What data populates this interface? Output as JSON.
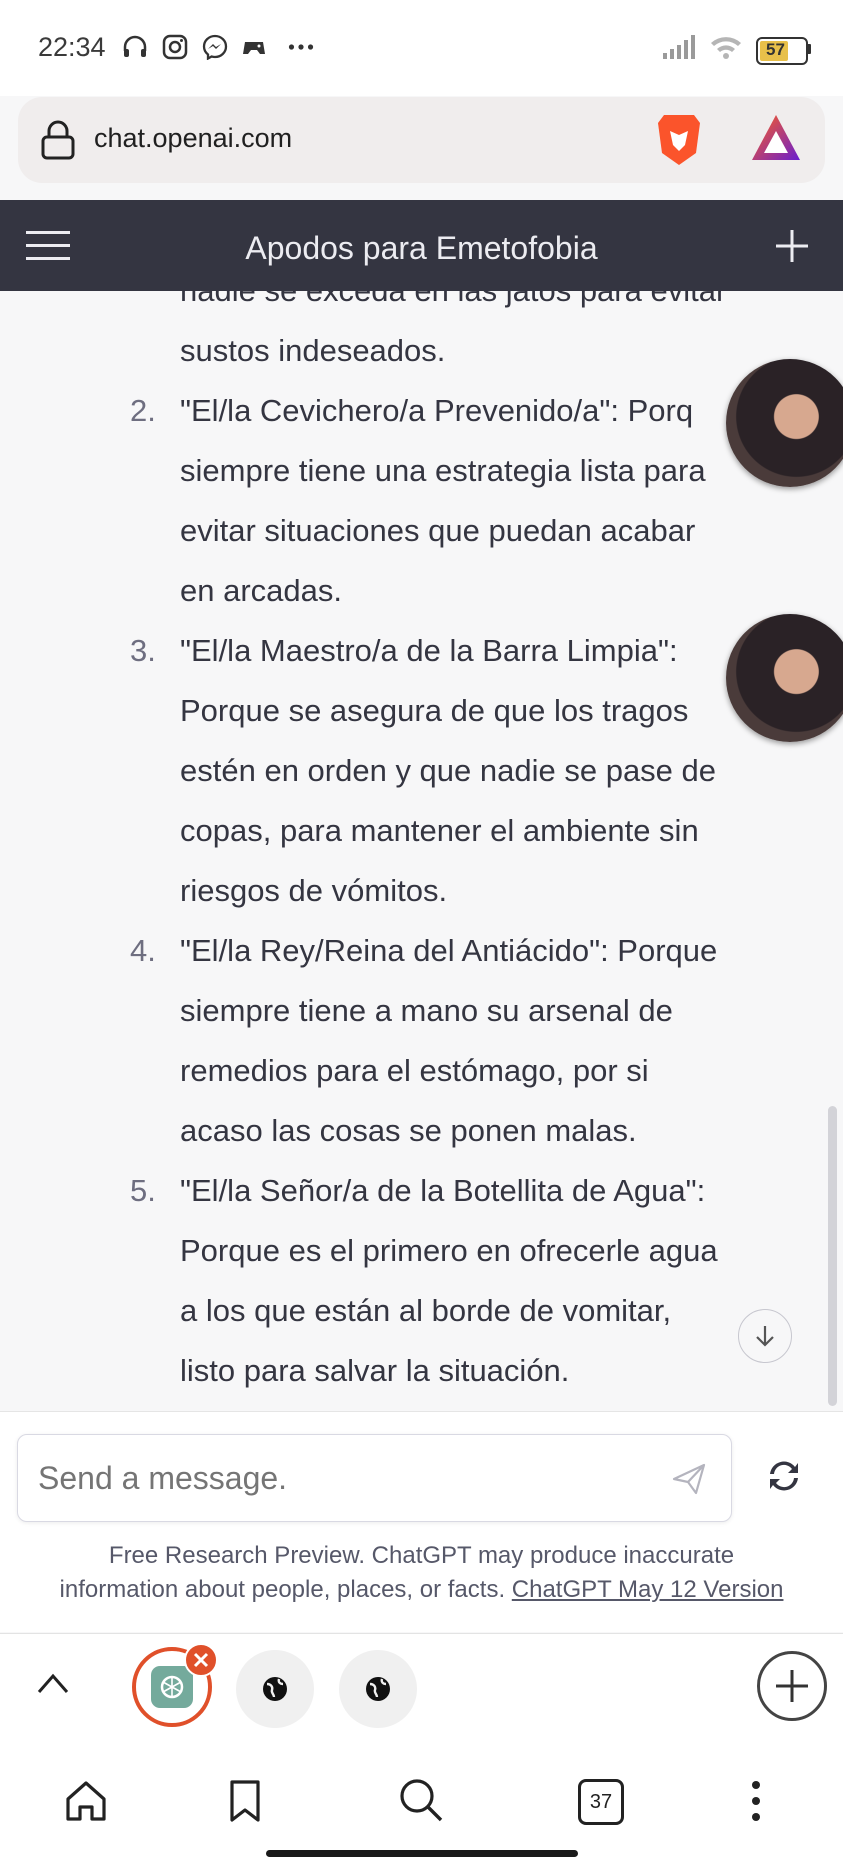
{
  "status_bar": {
    "time": "22:34",
    "battery": "57"
  },
  "browser": {
    "url": "chat.openai.com",
    "tab_count": "37"
  },
  "header": {
    "title": "Apodos para Emetofobia"
  },
  "chat": {
    "lines": [
      {
        "text": "nadie se exceda en las jatos para evitar"
      },
      {
        "text": "sustos indeseados."
      },
      {
        "num": "2.",
        "text": "\"El/la Cevichero/a Prevenido/a\": Porq"
      },
      {
        "text": "siempre tiene una estrategia lista para"
      },
      {
        "text": "evitar situaciones que puedan acabar"
      },
      {
        "text": "en arcadas."
      },
      {
        "num": "3.",
        "text": "\"El/la Maestro/a de la Barra Limpia\":"
      },
      {
        "text": "Porque se asegura de que los tragos"
      },
      {
        "text": "estén en orden y que nadie se pase de"
      },
      {
        "text": "copas, para mantener el ambiente sin"
      },
      {
        "text": "riesgos de vómitos."
      },
      {
        "num": "4.",
        "text": "\"El/la Rey/Reina del Antiácido\": Porque"
      },
      {
        "text": "siempre tiene a mano su arsenal de"
      },
      {
        "text": "remedios para el estómago, por si"
      },
      {
        "text": "acaso las cosas se ponen malas."
      },
      {
        "num": "5.",
        "text": "\"El/la Señor/a de la Botellita de Agua\":"
      },
      {
        "text": "Porque es el primero en ofrecerle agua"
      },
      {
        "text": "a los que están al borde de vomitar,"
      },
      {
        "text": "listo para salvar la situación."
      }
    ]
  },
  "composer": {
    "placeholder": "Send a message."
  },
  "disclaimer": {
    "line1": "Free Research Preview. ChatGPT may produce inaccurate",
    "line2_text": "information about people, places, or facts. ",
    "line2_link": "ChatGPT May 12 Version"
  },
  "icons": {
    "brave": "brave-lion-icon",
    "rewards": "brave-rewards-triangle-icon"
  },
  "colors": {
    "header_bg": "#343541",
    "brave_orange": "#fb542b",
    "tab_active_ring": "#e0502a"
  }
}
